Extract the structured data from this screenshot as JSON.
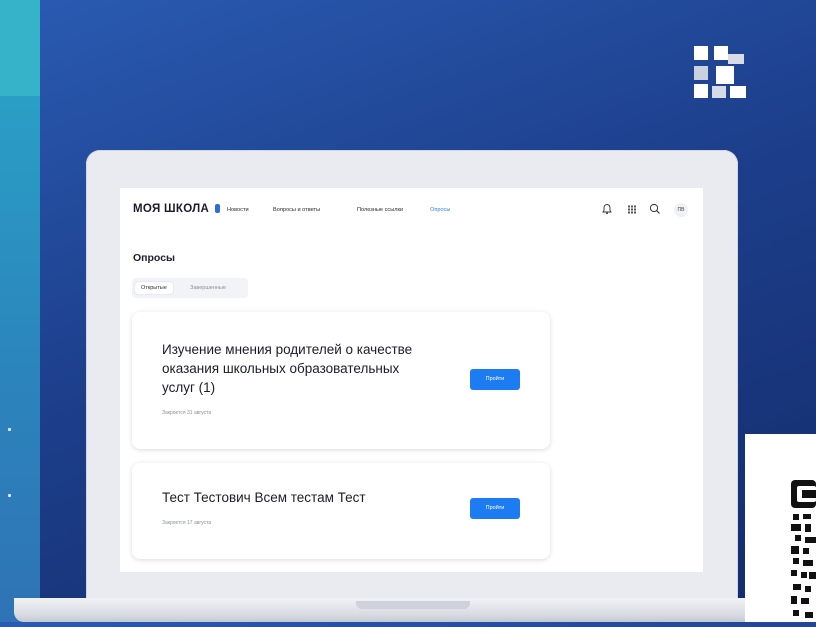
{
  "app": {
    "brand": "МОЯ ШКОЛА",
    "nav": [
      "Новости",
      "Вопросы и ответы",
      "Полезные ссылки",
      "Опросы"
    ],
    "active_nav_index": 3,
    "user_initials": "ПВ",
    "header_icons": [
      "bell-icon",
      "grid-icon",
      "search-icon"
    ]
  },
  "page": {
    "title": "Опросы",
    "tabs": [
      {
        "label": "Открытые",
        "active": true
      },
      {
        "label": "Завершенные",
        "active": false
      }
    ]
  },
  "surveys": [
    {
      "title_lines": [
        "Изучение мнения родителей о качестве",
        "оказания школьных образовательных",
        "услуг (1)"
      ],
      "date": "Закроется 31 августа",
      "button": "Пройти"
    },
    {
      "title_lines": [
        "Тест Тестович Всем тестам Тест"
      ],
      "date": "Закроется 17 августа",
      "button": "Пройти"
    }
  ],
  "colors": {
    "background": "#1d3f8c",
    "accent": "#1e7cf2",
    "left_strip": "#2aa8c9"
  }
}
